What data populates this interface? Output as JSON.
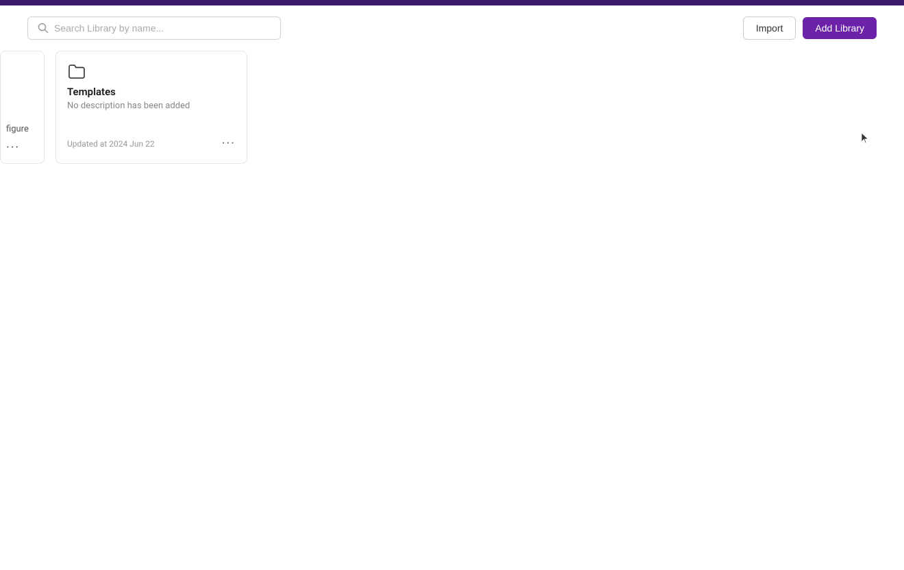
{
  "topbar": {
    "color": "#3d1a6e"
  },
  "toolbar": {
    "search": {
      "placeholder": "Search Library by name..."
    },
    "import_label": "Import",
    "add_library_label": "Add Library"
  },
  "partial_card": {
    "label": "figure",
    "dots": "···"
  },
  "library_card": {
    "title": "Templates",
    "description": "No description has been added",
    "updated_at": "Updated at 2024 Jun 22",
    "dots": "···"
  }
}
